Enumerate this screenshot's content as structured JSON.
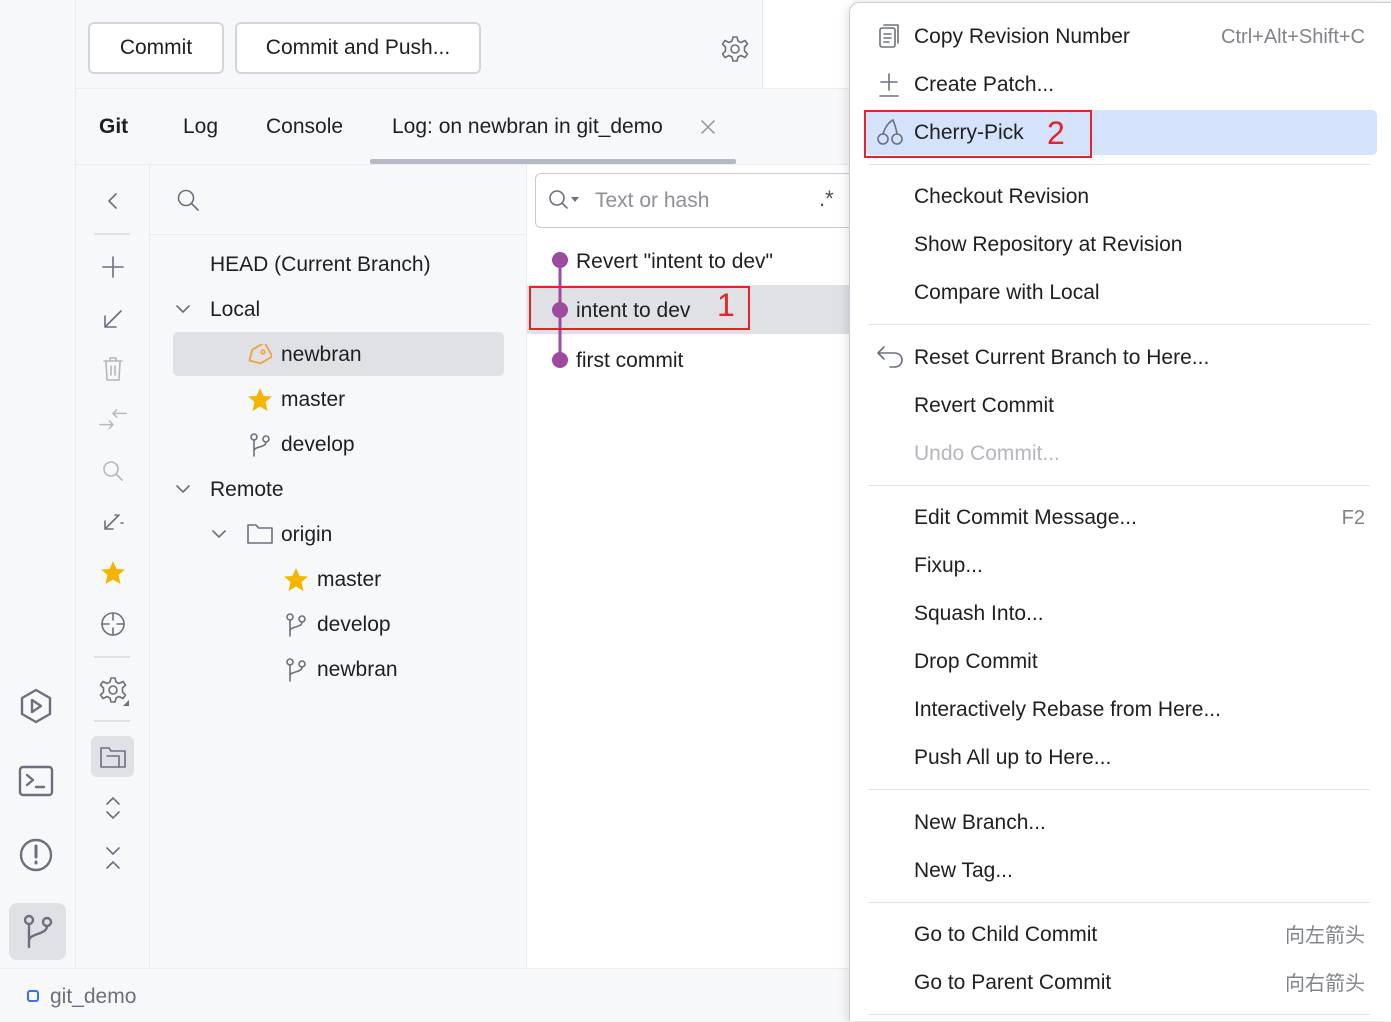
{
  "toolbar": {
    "commit_label": "Commit",
    "commit_push_label": "Commit and Push..."
  },
  "tabs": [
    {
      "label": "Git"
    },
    {
      "label": "Log"
    },
    {
      "label": "Console"
    },
    {
      "label": "Log: on newbran in git_demo"
    }
  ],
  "branches": {
    "head": "HEAD (Current Branch)",
    "local_label": "Local",
    "local": [
      "newbran",
      "master",
      "develop"
    ],
    "remote_label": "Remote",
    "origin_label": "origin",
    "remote": [
      "master",
      "develop",
      "newbran"
    ]
  },
  "log": {
    "search_placeholder": "Text or hash",
    "regex_label": ".*",
    "commits": [
      "Revert \"intent to dev\"",
      "intent to dev",
      "first commit"
    ],
    "graph_color": "#9c4ba1"
  },
  "context_menu": {
    "items": [
      {
        "label": "Copy Revision Number",
        "shortcut": "Ctrl+Alt+Shift+C"
      },
      {
        "label": "Create Patch..."
      },
      {
        "label": "Cherry-Pick"
      },
      {
        "label": "Checkout Revision"
      },
      {
        "label": "Show Repository at Revision"
      },
      {
        "label": "Compare with Local"
      },
      {
        "label": "Reset Current Branch to Here..."
      },
      {
        "label": "Revert Commit"
      },
      {
        "label": "Undo Commit..."
      },
      {
        "label": "Edit Commit Message...",
        "shortcut": "F2"
      },
      {
        "label": "Fixup..."
      },
      {
        "label": "Squash Into..."
      },
      {
        "label": "Drop Commit"
      },
      {
        "label": "Interactively Rebase from Here..."
      },
      {
        "label": "Push All up to Here..."
      },
      {
        "label": "New Branch..."
      },
      {
        "label": "New Tag..."
      },
      {
        "label": "Go to Child Commit",
        "shortcut": "向左箭头"
      },
      {
        "label": "Go to Parent Commit",
        "shortcut": "向右箭头"
      }
    ],
    "highlight_color": "#d4e2fb"
  },
  "annotations": [
    "1",
    "2"
  ],
  "status_bar": {
    "project": "git_demo"
  },
  "colors": {
    "annotation": "#e5232b",
    "star": "#f4b400",
    "tag": "#f2a33a"
  }
}
